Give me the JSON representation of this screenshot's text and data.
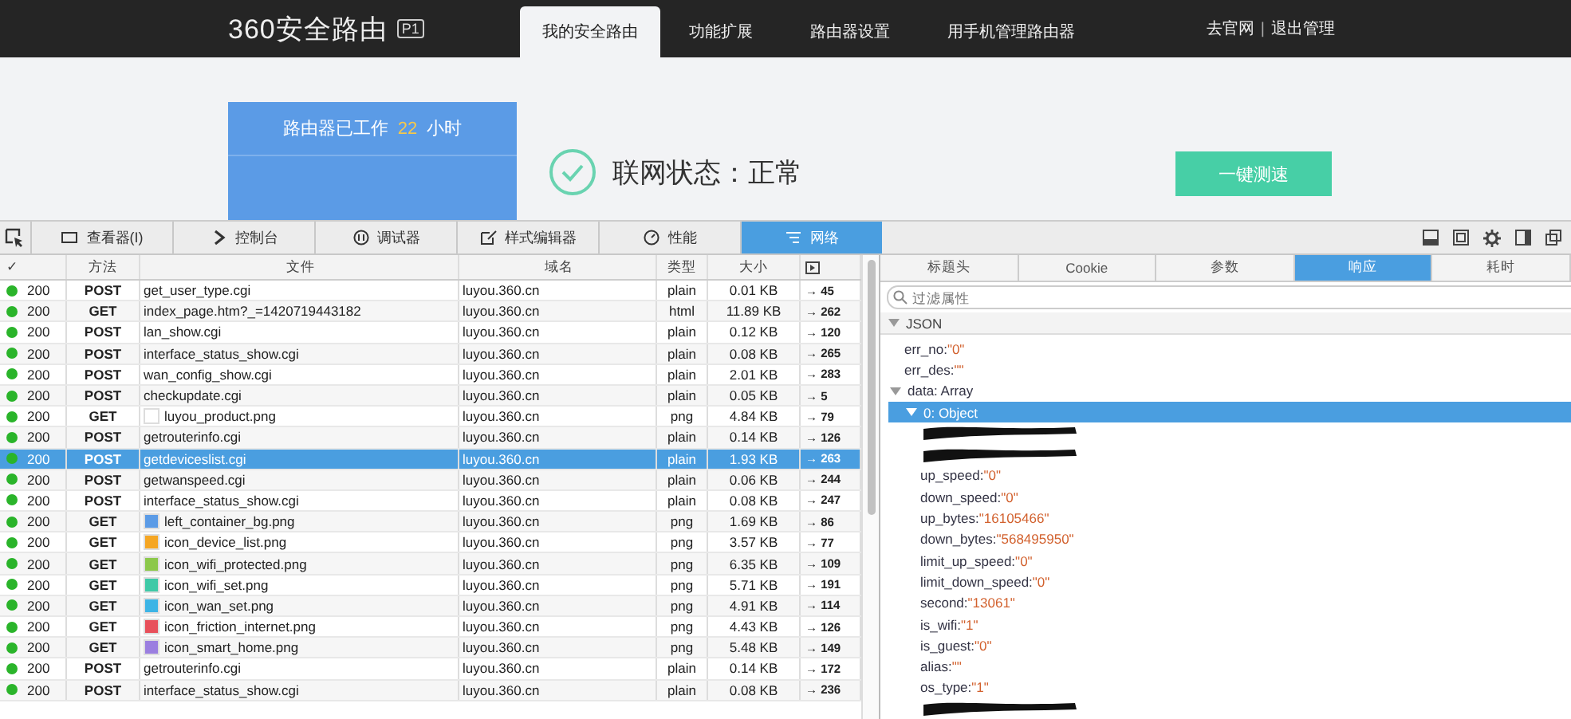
{
  "header": {
    "logo": "360安全路由",
    "badge": "P1",
    "tabs": [
      {
        "label": "我的安全路由",
        "selected": true
      },
      {
        "label": "功能扩展",
        "selected": false
      },
      {
        "label": "路由器设置",
        "selected": false
      },
      {
        "label": "用手机管理路由器",
        "selected": false
      }
    ],
    "links": [
      "去官网",
      "退出管理"
    ],
    "separator": "|"
  },
  "status_card": {
    "prefix": "路由器已工作",
    "hours": "22",
    "suffix": "小时"
  },
  "net_status": "联网状态：正常",
  "speed_button": "一键测速",
  "devtools": {
    "tabs": [
      {
        "label": "查看器(I)",
        "selected": false
      },
      {
        "label": "控制台",
        "selected": false
      },
      {
        "label": "调试器",
        "selected": false
      },
      {
        "label": "样式编辑器",
        "selected": false
      },
      {
        "label": "性能",
        "selected": false
      },
      {
        "label": "网络",
        "selected": true
      }
    ],
    "columns": [
      "✓",
      "方法",
      "文件",
      "域名",
      "类型",
      "大小"
    ],
    "rows": [
      {
        "status": "200",
        "method": "POST",
        "file": "get_user_type.cgi",
        "domain": "luyou.360.cn",
        "type": "plain",
        "size": "0.01 KB",
        "timing": "→ 45",
        "selected": false
      },
      {
        "status": "200",
        "method": "GET",
        "file": "index_page.htm?_=1420719443182",
        "domain": "luyou.360.cn",
        "type": "html",
        "size": "11.89 KB",
        "timing": "→ 262",
        "selected": false
      },
      {
        "status": "200",
        "method": "POST",
        "file": "lan_show.cgi",
        "domain": "luyou.360.cn",
        "type": "plain",
        "size": "0.12 KB",
        "timing": "→ 120",
        "selected": false
      },
      {
        "status": "200",
        "method": "POST",
        "file": "interface_status_show.cgi",
        "domain": "luyou.360.cn",
        "type": "plain",
        "size": "0.08 KB",
        "timing": "→ 265",
        "selected": false
      },
      {
        "status": "200",
        "method": "POST",
        "file": "wan_config_show.cgi",
        "domain": "luyou.360.cn",
        "type": "plain",
        "size": "2.01 KB",
        "timing": "→ 283",
        "selected": false
      },
      {
        "status": "200",
        "method": "POST",
        "file": "checkupdate.cgi",
        "domain": "luyou.360.cn",
        "type": "plain",
        "size": "0.05 KB",
        "timing": "→ 5",
        "selected": false
      },
      {
        "status": "200",
        "method": "GET",
        "file": "luyou_product.png",
        "domain": "luyou.360.cn",
        "type": "png",
        "size": "4.84 KB",
        "timing": "→ 79",
        "selected": false,
        "color": "#ffffff"
      },
      {
        "status": "200",
        "method": "POST",
        "file": "getrouterinfo.cgi",
        "domain": "luyou.360.cn",
        "type": "plain",
        "size": "0.14 KB",
        "timing": "→ 126",
        "selected": false
      },
      {
        "status": "200",
        "method": "POST",
        "file": "getdeviceslist.cgi",
        "domain": "luyou.360.cn",
        "type": "plain",
        "size": "1.93 KB",
        "timing": "→ 263",
        "selected": true
      },
      {
        "status": "200",
        "method": "POST",
        "file": "getwanspeed.cgi",
        "domain": "luyou.360.cn",
        "type": "plain",
        "size": "0.06 KB",
        "timing": "→ 244",
        "selected": false
      },
      {
        "status": "200",
        "method": "POST",
        "file": "interface_status_show.cgi",
        "domain": "luyou.360.cn",
        "type": "plain",
        "size": "0.08 KB",
        "timing": "→ 247",
        "selected": false
      },
      {
        "status": "200",
        "method": "GET",
        "file": "left_container_bg.png",
        "domain": "luyou.360.cn",
        "type": "png",
        "size": "1.69 KB",
        "timing": "→ 86",
        "selected": false,
        "color": "#5b9be6"
      },
      {
        "status": "200",
        "method": "GET",
        "file": "icon_device_list.png",
        "domain": "luyou.360.cn",
        "type": "png",
        "size": "3.57 KB",
        "timing": "→ 77",
        "selected": false,
        "color": "#f5a623"
      },
      {
        "status": "200",
        "method": "GET",
        "file": "icon_wifi_protected.png",
        "domain": "luyou.360.cn",
        "type": "png",
        "size": "6.35 KB",
        "timing": "→ 109",
        "selected": false,
        "color": "#8cc84b"
      },
      {
        "status": "200",
        "method": "GET",
        "file": "icon_wifi_set.png",
        "domain": "luyou.360.cn",
        "type": "png",
        "size": "5.71 KB",
        "timing": "→ 191",
        "selected": false,
        "color": "#3ec9a7"
      },
      {
        "status": "200",
        "method": "GET",
        "file": "icon_wan_set.png",
        "domain": "luyou.360.cn",
        "type": "png",
        "size": "4.91 KB",
        "timing": "→ 114",
        "selected": false,
        "color": "#3cb4e5"
      },
      {
        "status": "200",
        "method": "GET",
        "file": "icon_friction_internet.png",
        "domain": "luyou.360.cn",
        "type": "png",
        "size": "4.43 KB",
        "timing": "→ 126",
        "selected": false,
        "color": "#e8505b"
      },
      {
        "status": "200",
        "method": "GET",
        "file": "icon_smart_home.png",
        "domain": "luyou.360.cn",
        "type": "png",
        "size": "5.48 KB",
        "timing": "→ 149",
        "selected": false,
        "color": "#9b7fe0"
      },
      {
        "status": "200",
        "method": "POST",
        "file": "getrouterinfo.cgi",
        "domain": "luyou.360.cn",
        "type": "plain",
        "size": "0.14 KB",
        "timing": "→ 172",
        "selected": false
      },
      {
        "status": "200",
        "method": "POST",
        "file": "interface_status_show.cgi",
        "domain": "luyou.360.cn",
        "type": "plain",
        "size": "0.08 KB",
        "timing": "→ 236",
        "selected": false
      }
    ],
    "detail_tabs": [
      {
        "label": "标题头",
        "selected": false
      },
      {
        "label": "Cookie",
        "selected": false
      },
      {
        "label": "参数",
        "selected": false
      },
      {
        "label": "响应",
        "selected": true
      },
      {
        "label": "耗时",
        "selected": false
      }
    ],
    "filter": {
      "placeholder": "过滤属性"
    },
    "tree": {
      "label": "JSON",
      "expanded": true,
      "children": [
        {
          "kind": "value",
          "key": "err_no:",
          "value": "\"0\""
        },
        {
          "kind": "value",
          "key": "err_des:",
          "value": "\"\""
        },
        {
          "kind": "node",
          "key": "data:",
          "value": "Array",
          "expanded": true,
          "selected": false,
          "children": [
            {
              "kind": "node",
              "key": "0:",
              "value": "Object",
              "expanded": true,
              "selected": true,
              "children": [
                {
                  "kind": "redacted"
                },
                {
                  "kind": "redacted"
                },
                {
                  "kind": "value",
                  "key": "up_speed:",
                  "value": "\"0\""
                },
                {
                  "kind": "value",
                  "key": "down_speed:",
                  "value": "\"0\""
                },
                {
                  "kind": "value",
                  "key": "up_bytes:",
                  "value": "\"16105466\""
                },
                {
                  "kind": "value",
                  "key": "down_bytes:",
                  "value": "\"568495950\""
                },
                {
                  "kind": "value",
                  "key": "limit_up_speed:",
                  "value": "\"0\""
                },
                {
                  "kind": "value",
                  "key": "limit_down_speed:",
                  "value": "\"0\""
                },
                {
                  "kind": "value",
                  "key": "second:",
                  "value": "\"13061\""
                },
                {
                  "kind": "value",
                  "key": "is_wifi:",
                  "value": "\"1\""
                },
                {
                  "kind": "value",
                  "key": "is_guest:",
                  "value": "\"0\""
                },
                {
                  "kind": "value",
                  "key": "alias:",
                  "value": "\"\""
                },
                {
                  "kind": "value",
                  "key": "os_type:",
                  "value": "\"1\""
                },
                {
                  "kind": "redacted"
                }
              ]
            }
          ]
        }
      ]
    }
  }
}
